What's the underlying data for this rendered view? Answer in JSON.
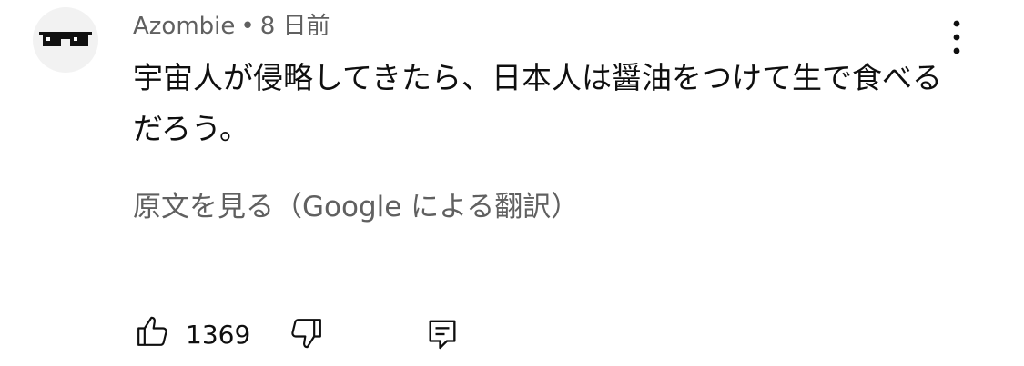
{
  "comment": {
    "author": "Azombie",
    "separator": "•",
    "time": "8 日前",
    "text": "宇宙人が侵略してきたら、日本人は醤油をつけて生で食べるだろう。",
    "translate_link": "原文を見る（Google による翻訳）",
    "like_count": "1369"
  },
  "icons": {
    "avatar": "pixel-sunglasses-icon",
    "more": "kebab-menu-icon",
    "like": "thumbs-up-icon",
    "dislike": "thumbs-down-icon",
    "reply": "reply-comment-icon"
  },
  "colors": {
    "text_primary": "#0f0f0f",
    "text_secondary": "#606060",
    "avatar_bg": "#f2f2f2"
  }
}
